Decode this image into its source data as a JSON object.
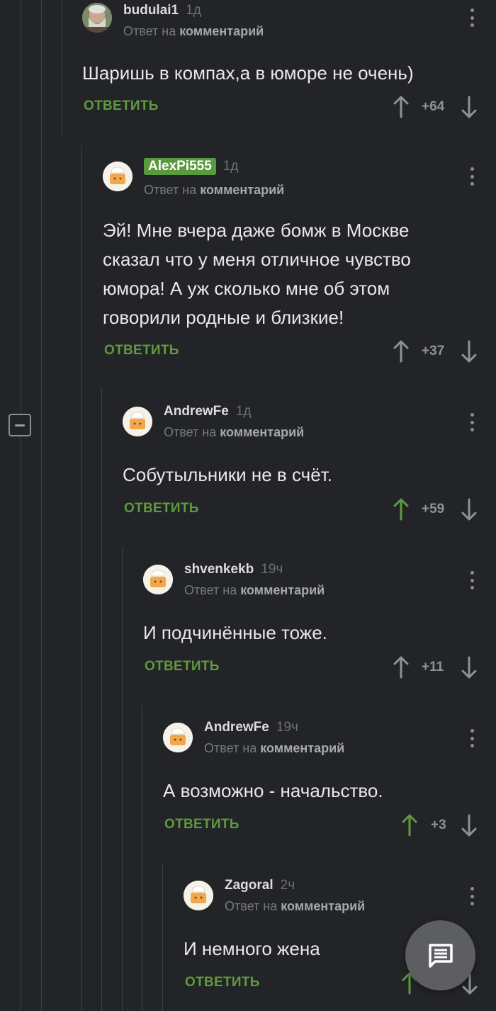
{
  "reply_prefix": "Ответ на",
  "reply_target": "комментарий",
  "reply_label": "ОТВЕТИТЬ",
  "comments": [
    {
      "author": "budulai1",
      "time": "1д",
      "text": "Шаришь в компах,а в юморе не очень)",
      "rating": "+64",
      "upvoted": false
    },
    {
      "author": "AlexPi555",
      "author_badge": true,
      "time": "1д",
      "text": "Эй! Мне вчера даже бомж в Москве\nсказал что у меня отличное чувство\nюмора! А уж сколько мне об этом\nговорили родные и близкие!",
      "rating": "+37",
      "upvoted": false
    },
    {
      "author": "AndrewFe",
      "time": "1д",
      "text": "Собутыльники не в счёт.",
      "rating": "+59",
      "upvoted": true
    },
    {
      "author": "shvenkekb",
      "time": "19ч",
      "text": "И подчинённые тоже.",
      "rating": "+11",
      "upvoted": false
    },
    {
      "author": "AndrewFe",
      "time": "19ч",
      "text": "А возможно - начальство.",
      "rating": "+3",
      "upvoted": true
    },
    {
      "author": "Zagoral",
      "time": "2ч",
      "text": "И немного жена",
      "rating": "",
      "upvoted": true
    }
  ],
  "icons": {
    "collapse": "minus-square-icon",
    "more": "kebab-menu-icon",
    "upvote": "arrow-up-icon",
    "downvote": "arrow-down-icon",
    "fab": "comment-icon"
  },
  "colors": {
    "background": "#232427",
    "accent_green": "#5e9b3c",
    "badge_green": "#5a9a3e",
    "muted": "#8f9195"
  }
}
